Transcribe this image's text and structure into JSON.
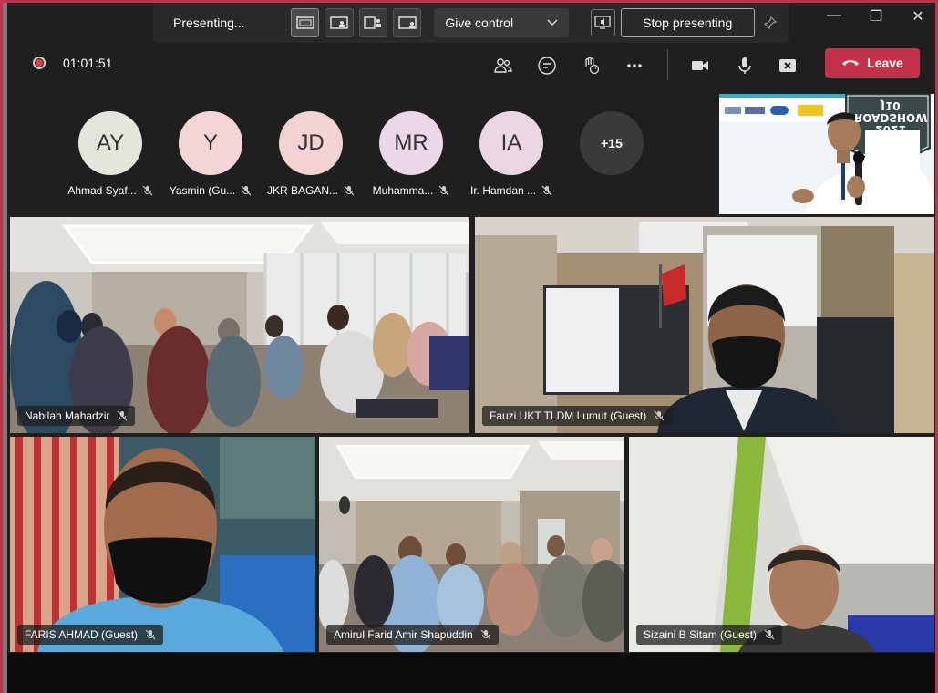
{
  "present_bar": {
    "label": "Presenting...",
    "give_control": "Give control",
    "stop_label": "Stop presenting"
  },
  "meeting": {
    "timer": "01:01:51",
    "leave_label": "Leave"
  },
  "participants": [
    {
      "initials": "AY",
      "name": "Ahmad Syaf...",
      "color": "#e2e6dc"
    },
    {
      "initials": "Y",
      "name": "Yasmin (Gu...",
      "color": "#f3d5d7"
    },
    {
      "initials": "JD",
      "name": "JKR BAGAN...",
      "color": "#f2d2d2"
    },
    {
      "initials": "MR",
      "name": "Muhamma...",
      "color": "#ecd7e6"
    },
    {
      "initials": "IA",
      "name": "Ir. Hamdan ...",
      "color": "#ecd6e4"
    }
  ],
  "more_count": "+15",
  "presenter_banner": {
    "line1": "J10",
    "line2": "ROADSHOW",
    "line3": "2021"
  },
  "tiles": [
    {
      "name": "Nabilah Mahadzir"
    },
    {
      "name": "Fauzi UKT TLDM Lumut (Guest)"
    },
    {
      "name": "FARIS AHMAD (Guest)"
    },
    {
      "name": "Amirul Farid Amir Shapuddin"
    },
    {
      "name": "Sizaini B Sitam (Guest)"
    }
  ],
  "colors": {
    "accent_red": "#c4314b",
    "toolbar_bg": "#292929",
    "app_bg": "#1f1f1f"
  }
}
